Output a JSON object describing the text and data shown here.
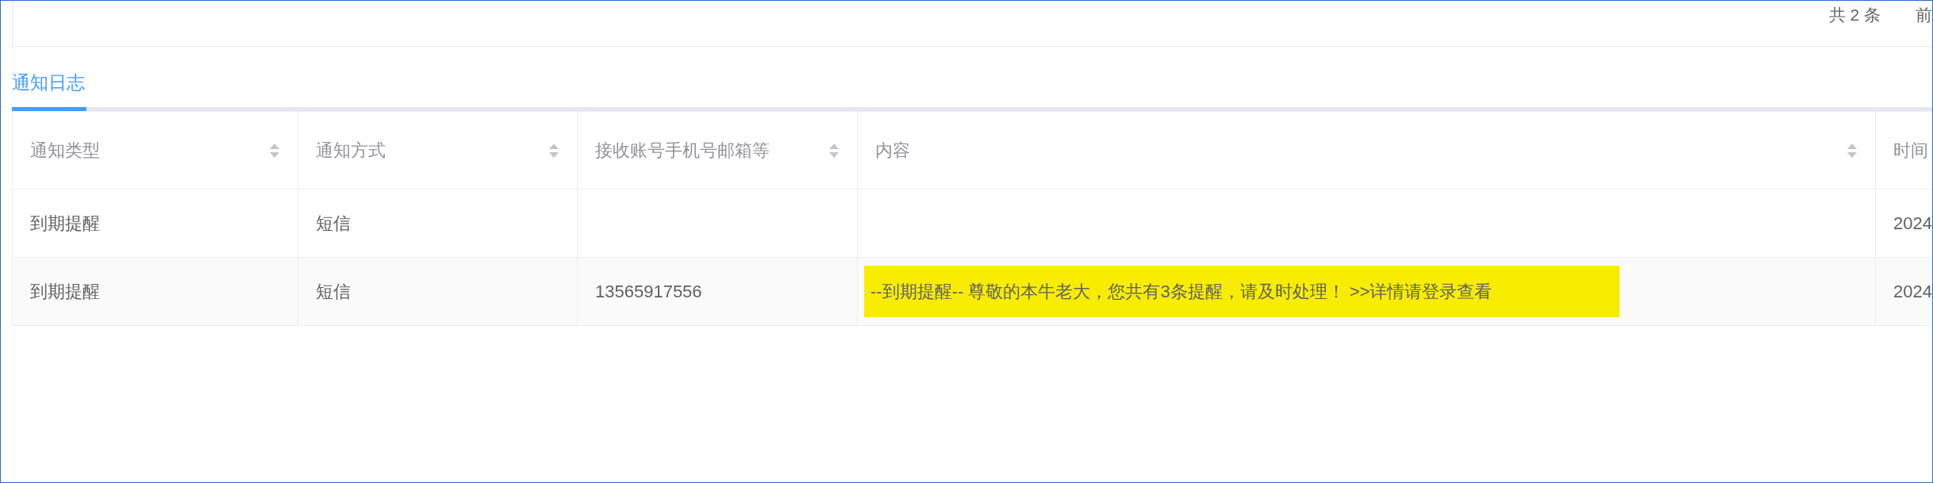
{
  "pagination": {
    "total": "共 2 条",
    "goto": "前"
  },
  "tabs": [
    {
      "label": "通知日志",
      "selected": true
    }
  ],
  "table": {
    "columns": [
      {
        "label": "通知类型",
        "kind": "sortable"
      },
      {
        "label": "通知方式",
        "kind": "sortable"
      },
      {
        "label": "接收账号手机号邮箱等",
        "kind": "sortable"
      },
      {
        "label": "内容",
        "kind": "sortable"
      },
      {
        "label": "时间",
        "kind": "plain"
      }
    ],
    "rows": [
      {
        "cells": [
          "到期提醒",
          "短信",
          "",
          "",
          "2024"
        ]
      },
      {
        "cells": [
          "到期提醒",
          "短信",
          "13565917556",
          "--到期提醒-- 尊敬的本牛老大，您共有3条提醒，请及时处理！ >>详情请登录查看",
          "2024"
        ],
        "color": "#f8ec00"
      }
    ]
  }
}
